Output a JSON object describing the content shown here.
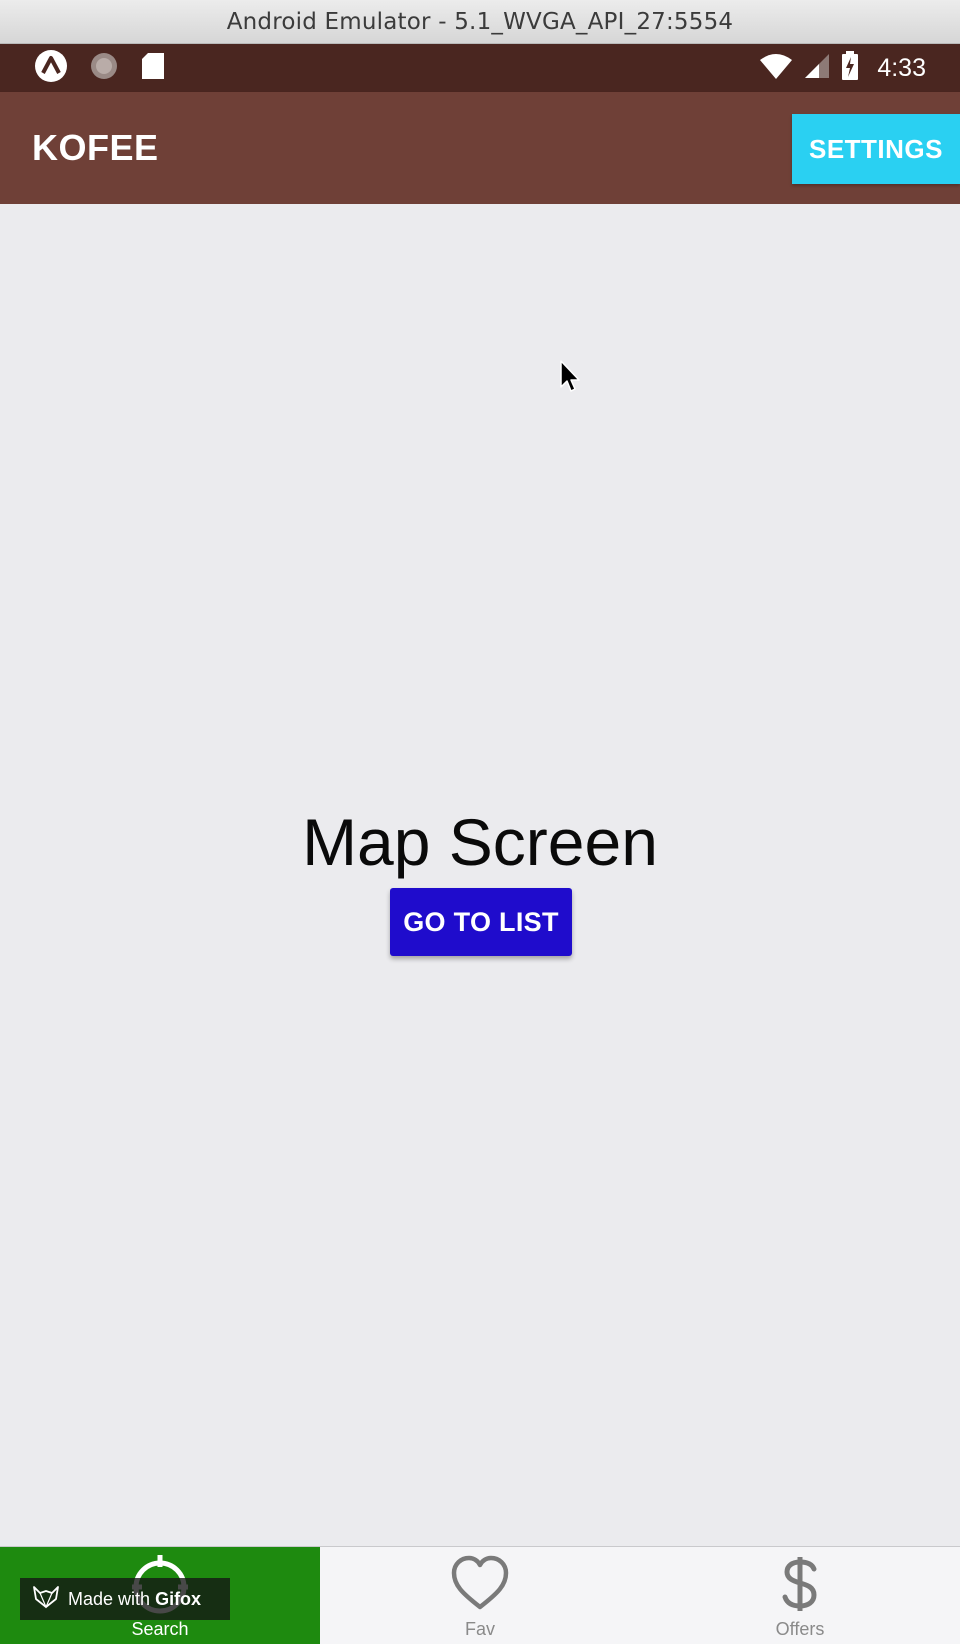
{
  "window": {
    "title": "Android Emulator - 5.1_WVGA_API_27:5554"
  },
  "status_bar": {
    "time": "4:33",
    "left_icons": [
      "app-notification-icon",
      "dot-notification-icon",
      "sd-card-icon"
    ],
    "right_icons": [
      "wifi-icon",
      "cell-signal-icon",
      "battery-charging-icon"
    ]
  },
  "header": {
    "title": "KOFEE",
    "settings_label": "SETTINGS"
  },
  "main": {
    "title": "Map Screen",
    "go_to_list_label": "GO TO LIST"
  },
  "tabs": [
    {
      "label": "Search",
      "icon": "search-target-icon",
      "active": true
    },
    {
      "label": "Fav",
      "icon": "heart-icon",
      "active": false
    },
    {
      "label": "Offers",
      "icon": "dollar-icon",
      "active": false
    }
  ],
  "watermark": {
    "prefix": "Made with",
    "brand": "Gifox"
  },
  "colors": {
    "status_bar": "#4a2620",
    "header": "#6f4037",
    "settings_button": "#2ad0f2",
    "primary_button": "#1f0ccc",
    "active_tab": "#1e8a0f",
    "background": "#ebebee"
  }
}
